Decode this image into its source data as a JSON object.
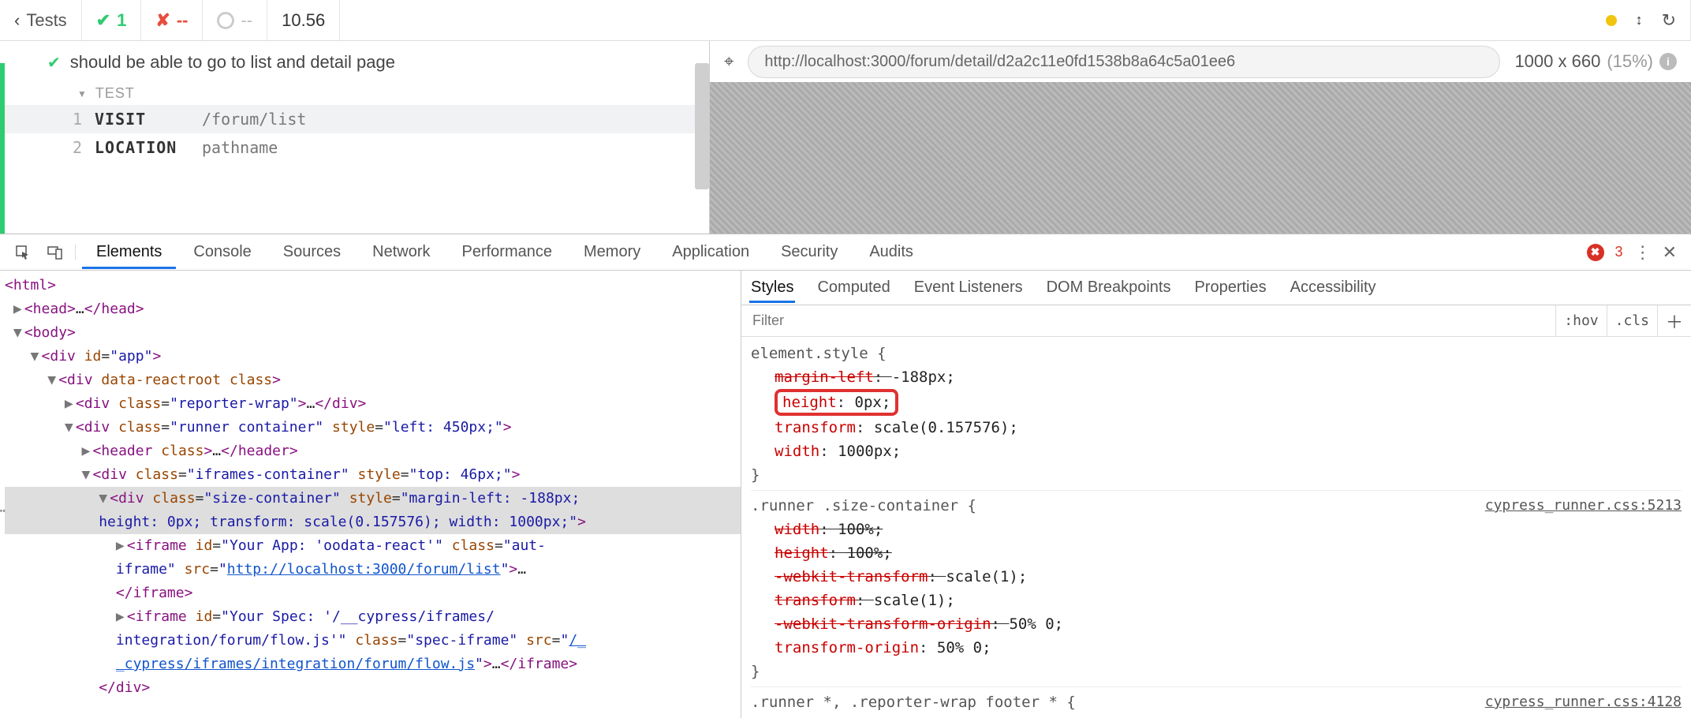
{
  "cy": {
    "back_label": "Tests",
    "pass_count": "1",
    "fail_count": "--",
    "pending_count": "--",
    "duration": "10.56",
    "test_title": "should be able to go to list and detail page",
    "section": "TEST",
    "commands": [
      {
        "n": "1",
        "name": "VISIT",
        "arg": "/forum/list"
      },
      {
        "n": "2",
        "name": "LOCATION",
        "arg": "pathname"
      }
    ]
  },
  "aut": {
    "url": "http://localhost:3000/forum/detail/d2a2c11e0fd1538b8a64c5a01ee6",
    "viewport": "1000 x 660",
    "scale_pct": "(15%)"
  },
  "devtools": {
    "tabs": [
      "Elements",
      "Console",
      "Sources",
      "Network",
      "Performance",
      "Memory",
      "Application",
      "Security",
      "Audits"
    ],
    "active_tab": "Elements",
    "errors": "3",
    "style_tabs": [
      "Styles",
      "Computed",
      "Event Listeners",
      "DOM Breakpoints",
      "Properties",
      "Accessibility"
    ],
    "active_style_tab": "Styles",
    "filter_placeholder": "Filter",
    "hov": ":hov",
    "cls": ".cls"
  },
  "dom": {
    "l0": "<html>",
    "l1a": "<head>",
    "l1b": "</head>",
    "l1dots": "…",
    "l2": "<body>",
    "l3_tag": "div",
    "l3_attr": "id",
    "l3_val": "\"app\"",
    "l4_tag": "div",
    "l4_attr1": "data-reactroot",
    "l4_attr2": "class",
    "l5_tag": "div",
    "l5_attr": "class",
    "l5_val": "\"reporter-wrap\"",
    "l5_end": "</div>",
    "l5dots": "…",
    "l6_tag": "div",
    "l6_attr": "class",
    "l6_val": "\"runner container\"",
    "l6_sattr": "style",
    "l6_sval": "\"left: 450px;\"",
    "l7_tag": "header",
    "l7_attr": "class",
    "l7_end": "</header>",
    "l7dots": "…",
    "l8_tag": "div",
    "l8_attr": "class",
    "l8_val": "\"iframes-container\"",
    "l8_sattr": "style",
    "l8_sval": "\"top: 46px;\"",
    "l9_tag": "div",
    "l9_attr": "class",
    "l9_val": "\"size-container\"",
    "l9_sattr": "style",
    "l9_sval1": "\"margin-left: -188px;",
    "l9_sval2": "height: 0px; transform: scale(0.157576); width: 1000px;\"",
    "l10_tag": "iframe",
    "l10_a1": "id",
    "l10_v1": "\"Your App: 'oodata-react'\"",
    "l10_a2": "class",
    "l10_v2": "\"aut-",
    "l10_v2b": "iframe\"",
    "l10_a3": "src",
    "l10_link": "http://localhost:3000/forum/list",
    "l10_end": "</iframe>",
    "l10dots": "…",
    "l11_tag": "iframe",
    "l11_a1": "id",
    "l11_v1": "\"Your Spec: '/__cypress/iframes/",
    "l11_v1b": "integration/forum/flow.js'\"",
    "l11_a2": "class",
    "l11_v2": "\"spec-iframe\"",
    "l11_a3": "src",
    "l11_link1": "/_",
    "l11_link2": "_cypress/iframes/integration/forum/flow.js",
    "l11_end": "</iframe>",
    "l11dots": "…",
    "l12": "</div>"
  },
  "styles": {
    "r1_sel": "element.style {",
    "r1_p1": "margin-left",
    "r1_v1": "-188px;",
    "r1_p2": "height",
    "r1_v2": "0px;",
    "r1_p3": "transform",
    "r1_v3": "scale(0.157576);",
    "r1_p4": "width",
    "r1_v4": "1000px;",
    "close": "}",
    "r2_sel": ".runner .size-container {",
    "r2_src": "cypress_runner.css:5213",
    "r2_p1": "width",
    "r2_v1": "100%;",
    "r2_p2": "height",
    "r2_v2": "100%;",
    "r2_p3": "-webkit-transform",
    "r2_v3": "scale(1);",
    "r2_p4": "transform",
    "r2_v4": "scale(1);",
    "r2_p5": "-webkit-transform-origin",
    "r2_v5": "50% 0;",
    "r2_p6": "transform-origin",
    "r2_v6": "50% 0;",
    "r3_sel": ".runner *, .reporter-wrap footer * {",
    "r3_src": "cypress_runner.css:4128"
  }
}
